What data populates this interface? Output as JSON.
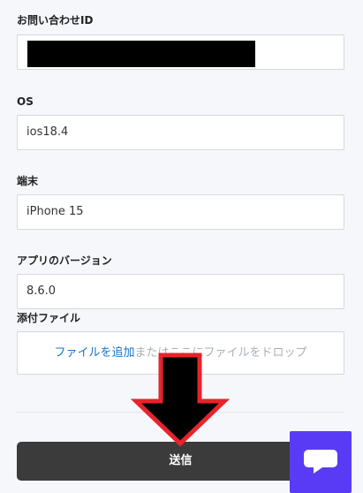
{
  "form": {
    "inquiry_id": {
      "label": "お問い合わせID",
      "value": ""
    },
    "os": {
      "label": "OS",
      "value": "ios18.4"
    },
    "device": {
      "label": "端末",
      "value": "iPhone 15"
    },
    "app_version": {
      "label": "アプリのバージョン",
      "value": "8.6.0"
    },
    "attachment": {
      "label": "添付ファイル",
      "link_text": "ファイルを追加",
      "rest_text": "またはここにファイルをドロップ"
    },
    "submit_label": "送信"
  },
  "icons": {
    "annotation_arrow": "arrow-down-icon",
    "chat": "chat-bubble-icon"
  },
  "colors": {
    "link": "#1a73c5",
    "submit_bg": "#3b3b3b",
    "chat_bg": "#5a3bf5",
    "arrow_outline": "#e8232b"
  }
}
